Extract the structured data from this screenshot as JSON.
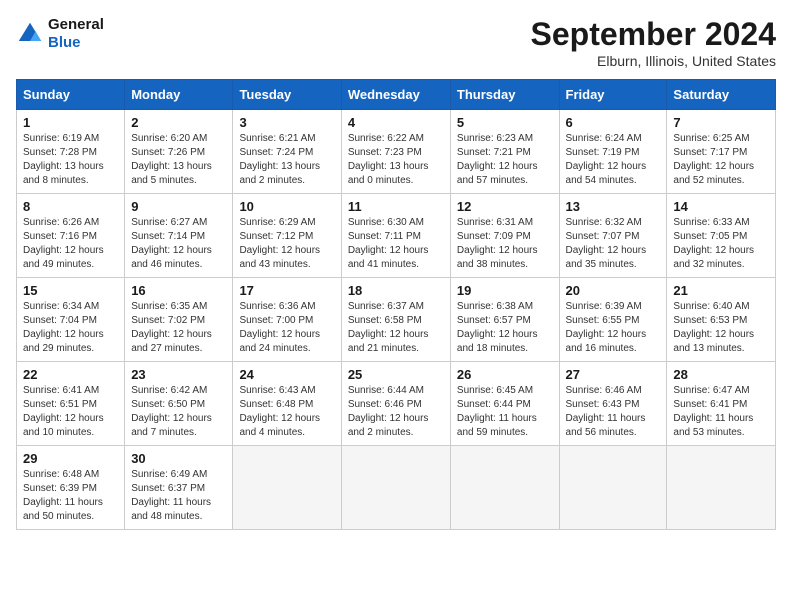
{
  "header": {
    "logo_line1": "General",
    "logo_line2": "Blue",
    "month_title": "September 2024",
    "location": "Elburn, Illinois, United States"
  },
  "days_of_week": [
    "Sunday",
    "Monday",
    "Tuesday",
    "Wednesday",
    "Thursday",
    "Friday",
    "Saturday"
  ],
  "weeks": [
    [
      {
        "day": "1",
        "sunrise": "6:19 AM",
        "sunset": "7:28 PM",
        "daylight": "13 hours and 8 minutes."
      },
      {
        "day": "2",
        "sunrise": "6:20 AM",
        "sunset": "7:26 PM",
        "daylight": "13 hours and 5 minutes."
      },
      {
        "day": "3",
        "sunrise": "6:21 AM",
        "sunset": "7:24 PM",
        "daylight": "13 hours and 2 minutes."
      },
      {
        "day": "4",
        "sunrise": "6:22 AM",
        "sunset": "7:23 PM",
        "daylight": "13 hours and 0 minutes."
      },
      {
        "day": "5",
        "sunrise": "6:23 AM",
        "sunset": "7:21 PM",
        "daylight": "12 hours and 57 minutes."
      },
      {
        "day": "6",
        "sunrise": "6:24 AM",
        "sunset": "7:19 PM",
        "daylight": "12 hours and 54 minutes."
      },
      {
        "day": "7",
        "sunrise": "6:25 AM",
        "sunset": "7:17 PM",
        "daylight": "12 hours and 52 minutes."
      }
    ],
    [
      {
        "day": "8",
        "sunrise": "6:26 AM",
        "sunset": "7:16 PM",
        "daylight": "12 hours and 49 minutes."
      },
      {
        "day": "9",
        "sunrise": "6:27 AM",
        "sunset": "7:14 PM",
        "daylight": "12 hours and 46 minutes."
      },
      {
        "day": "10",
        "sunrise": "6:29 AM",
        "sunset": "7:12 PM",
        "daylight": "12 hours and 43 minutes."
      },
      {
        "day": "11",
        "sunrise": "6:30 AM",
        "sunset": "7:11 PM",
        "daylight": "12 hours and 41 minutes."
      },
      {
        "day": "12",
        "sunrise": "6:31 AM",
        "sunset": "7:09 PM",
        "daylight": "12 hours and 38 minutes."
      },
      {
        "day": "13",
        "sunrise": "6:32 AM",
        "sunset": "7:07 PM",
        "daylight": "12 hours and 35 minutes."
      },
      {
        "day": "14",
        "sunrise": "6:33 AM",
        "sunset": "7:05 PM",
        "daylight": "12 hours and 32 minutes."
      }
    ],
    [
      {
        "day": "15",
        "sunrise": "6:34 AM",
        "sunset": "7:04 PM",
        "daylight": "12 hours and 29 minutes."
      },
      {
        "day": "16",
        "sunrise": "6:35 AM",
        "sunset": "7:02 PM",
        "daylight": "12 hours and 27 minutes."
      },
      {
        "day": "17",
        "sunrise": "6:36 AM",
        "sunset": "7:00 PM",
        "daylight": "12 hours and 24 minutes."
      },
      {
        "day": "18",
        "sunrise": "6:37 AM",
        "sunset": "6:58 PM",
        "daylight": "12 hours and 21 minutes."
      },
      {
        "day": "19",
        "sunrise": "6:38 AM",
        "sunset": "6:57 PM",
        "daylight": "12 hours and 18 minutes."
      },
      {
        "day": "20",
        "sunrise": "6:39 AM",
        "sunset": "6:55 PM",
        "daylight": "12 hours and 16 minutes."
      },
      {
        "day": "21",
        "sunrise": "6:40 AM",
        "sunset": "6:53 PM",
        "daylight": "12 hours and 13 minutes."
      }
    ],
    [
      {
        "day": "22",
        "sunrise": "6:41 AM",
        "sunset": "6:51 PM",
        "daylight": "12 hours and 10 minutes."
      },
      {
        "day": "23",
        "sunrise": "6:42 AM",
        "sunset": "6:50 PM",
        "daylight": "12 hours and 7 minutes."
      },
      {
        "day": "24",
        "sunrise": "6:43 AM",
        "sunset": "6:48 PM",
        "daylight": "12 hours and 4 minutes."
      },
      {
        "day": "25",
        "sunrise": "6:44 AM",
        "sunset": "6:46 PM",
        "daylight": "12 hours and 2 minutes."
      },
      {
        "day": "26",
        "sunrise": "6:45 AM",
        "sunset": "6:44 PM",
        "daylight": "11 hours and 59 minutes."
      },
      {
        "day": "27",
        "sunrise": "6:46 AM",
        "sunset": "6:43 PM",
        "daylight": "11 hours and 56 minutes."
      },
      {
        "day": "28",
        "sunrise": "6:47 AM",
        "sunset": "6:41 PM",
        "daylight": "11 hours and 53 minutes."
      }
    ],
    [
      {
        "day": "29",
        "sunrise": "6:48 AM",
        "sunset": "6:39 PM",
        "daylight": "11 hours and 50 minutes."
      },
      {
        "day": "30",
        "sunrise": "6:49 AM",
        "sunset": "6:37 PM",
        "daylight": "11 hours and 48 minutes."
      },
      null,
      null,
      null,
      null,
      null
    ]
  ]
}
